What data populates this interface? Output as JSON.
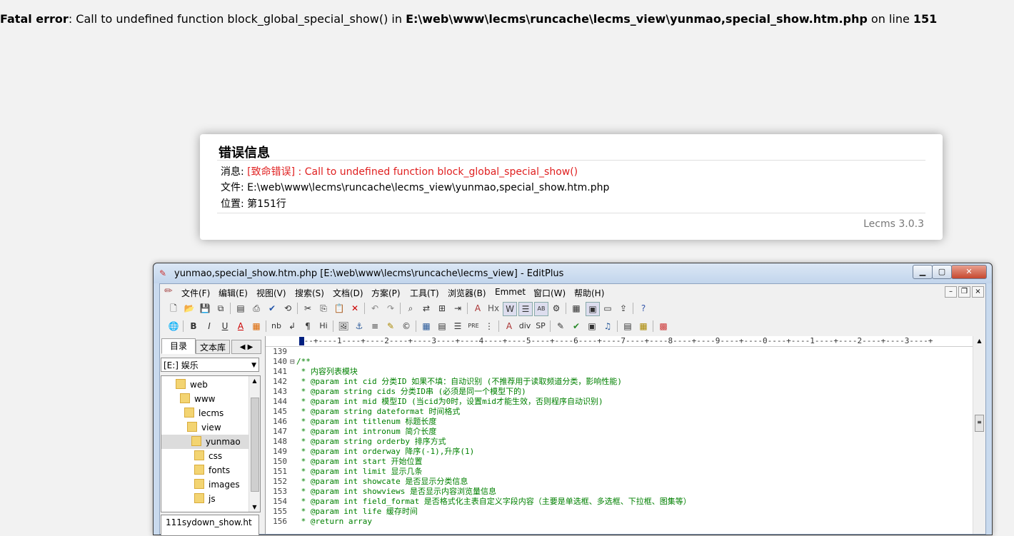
{
  "fatal": {
    "label": "Fatal error",
    "message": ": Call to undefined function block_global_special_show() in ",
    "file": "E:\\web\\www\\lecms\\runcache\\lecms_view\\yunmao,special_show.htm.php",
    "on_line": " on line ",
    "line": "151"
  },
  "error_card": {
    "title": "错误信息",
    "msg_label": "消息: ",
    "msg_value": "[致命错误] : Call to undefined function block_global_special_show()",
    "file_label": "文件: ",
    "file_value": "E:\\web\\www\\lecms\\runcache\\lecms_view\\yunmao,special_show.htm.php",
    "pos_label": "位置: ",
    "pos_value": "第151行",
    "version": "Lecms 3.0.3"
  },
  "window": {
    "title": "yunmao,special_show.htm.php [E:\\web\\www\\lecms\\runcache\\lecms_view] - EditPlus",
    "menu": [
      "文件(F)",
      "编辑(E)",
      "视图(V)",
      "搜索(S)",
      "文档(D)",
      "方案(P)",
      "工具(T)",
      "浏览器(B)",
      "Emmet",
      "窗口(W)",
      "帮助(H)"
    ]
  },
  "sidebar": {
    "tab_dir": "目录",
    "tab_text": "文本库",
    "drive": "[E:] 娱乐",
    "tree": [
      "web",
      "www",
      "lecms",
      "view",
      "yunmao",
      "css",
      "fonts",
      "images",
      "js"
    ],
    "selected": "yunmao",
    "file_list_first": "111sydown_show.ht"
  },
  "editor": {
    "ruler": "---+----1----+----2----+----3----+----4----+----5----+----6----+----7----+----8----+----9----+----0----+----1----+----2----+----3----+",
    "lines": [
      {
        "n": "139",
        "fold": "",
        "text": ""
      },
      {
        "n": "140",
        "fold": "⊟",
        "text": "/**"
      },
      {
        "n": "141",
        "fold": "",
        "text": " * 内容列表模块"
      },
      {
        "n": "142",
        "fold": "",
        "text": " * @param int cid 分类ID 如果不填：自动识别 (不推荐用于读取频道分类，影响性能)"
      },
      {
        "n": "143",
        "fold": "",
        "text": " * @param string cids 分类ID串 (必须是同一个模型下的)"
      },
      {
        "n": "144",
        "fold": "",
        "text": " * @param int mid 模型ID (当cid为0时，设置mid才能生效，否则程序自动识别)"
      },
      {
        "n": "145",
        "fold": "",
        "text": " * @param string dateformat 时间格式"
      },
      {
        "n": "146",
        "fold": "",
        "text": " * @param int titlenum 标题长度"
      },
      {
        "n": "147",
        "fold": "",
        "text": " * @param int intronum 简介长度"
      },
      {
        "n": "148",
        "fold": "",
        "text": " * @param string orderby 排序方式"
      },
      {
        "n": "149",
        "fold": "",
        "text": " * @param int orderway 降序(-1),升序(1)"
      },
      {
        "n": "150",
        "fold": "",
        "text": " * @param int start 开始位置"
      },
      {
        "n": "151",
        "fold": "",
        "text": " * @param int limit 显示几条"
      },
      {
        "n": "152",
        "fold": "",
        "text": " * @param int showcate 是否显示分类信息"
      },
      {
        "n": "153",
        "fold": "",
        "text": " * @param int showviews 是否显示内容浏览量信息"
      },
      {
        "n": "154",
        "fold": "",
        "text": " * @param int field_format 是否格式化主表自定义字段内容（主要是单选框、多选框、下拉框、图集等）"
      },
      {
        "n": "155",
        "fold": "",
        "text": " * @param int life 缓存时间"
      },
      {
        "n": "156",
        "fold": "",
        "text": " * @return array"
      }
    ]
  }
}
